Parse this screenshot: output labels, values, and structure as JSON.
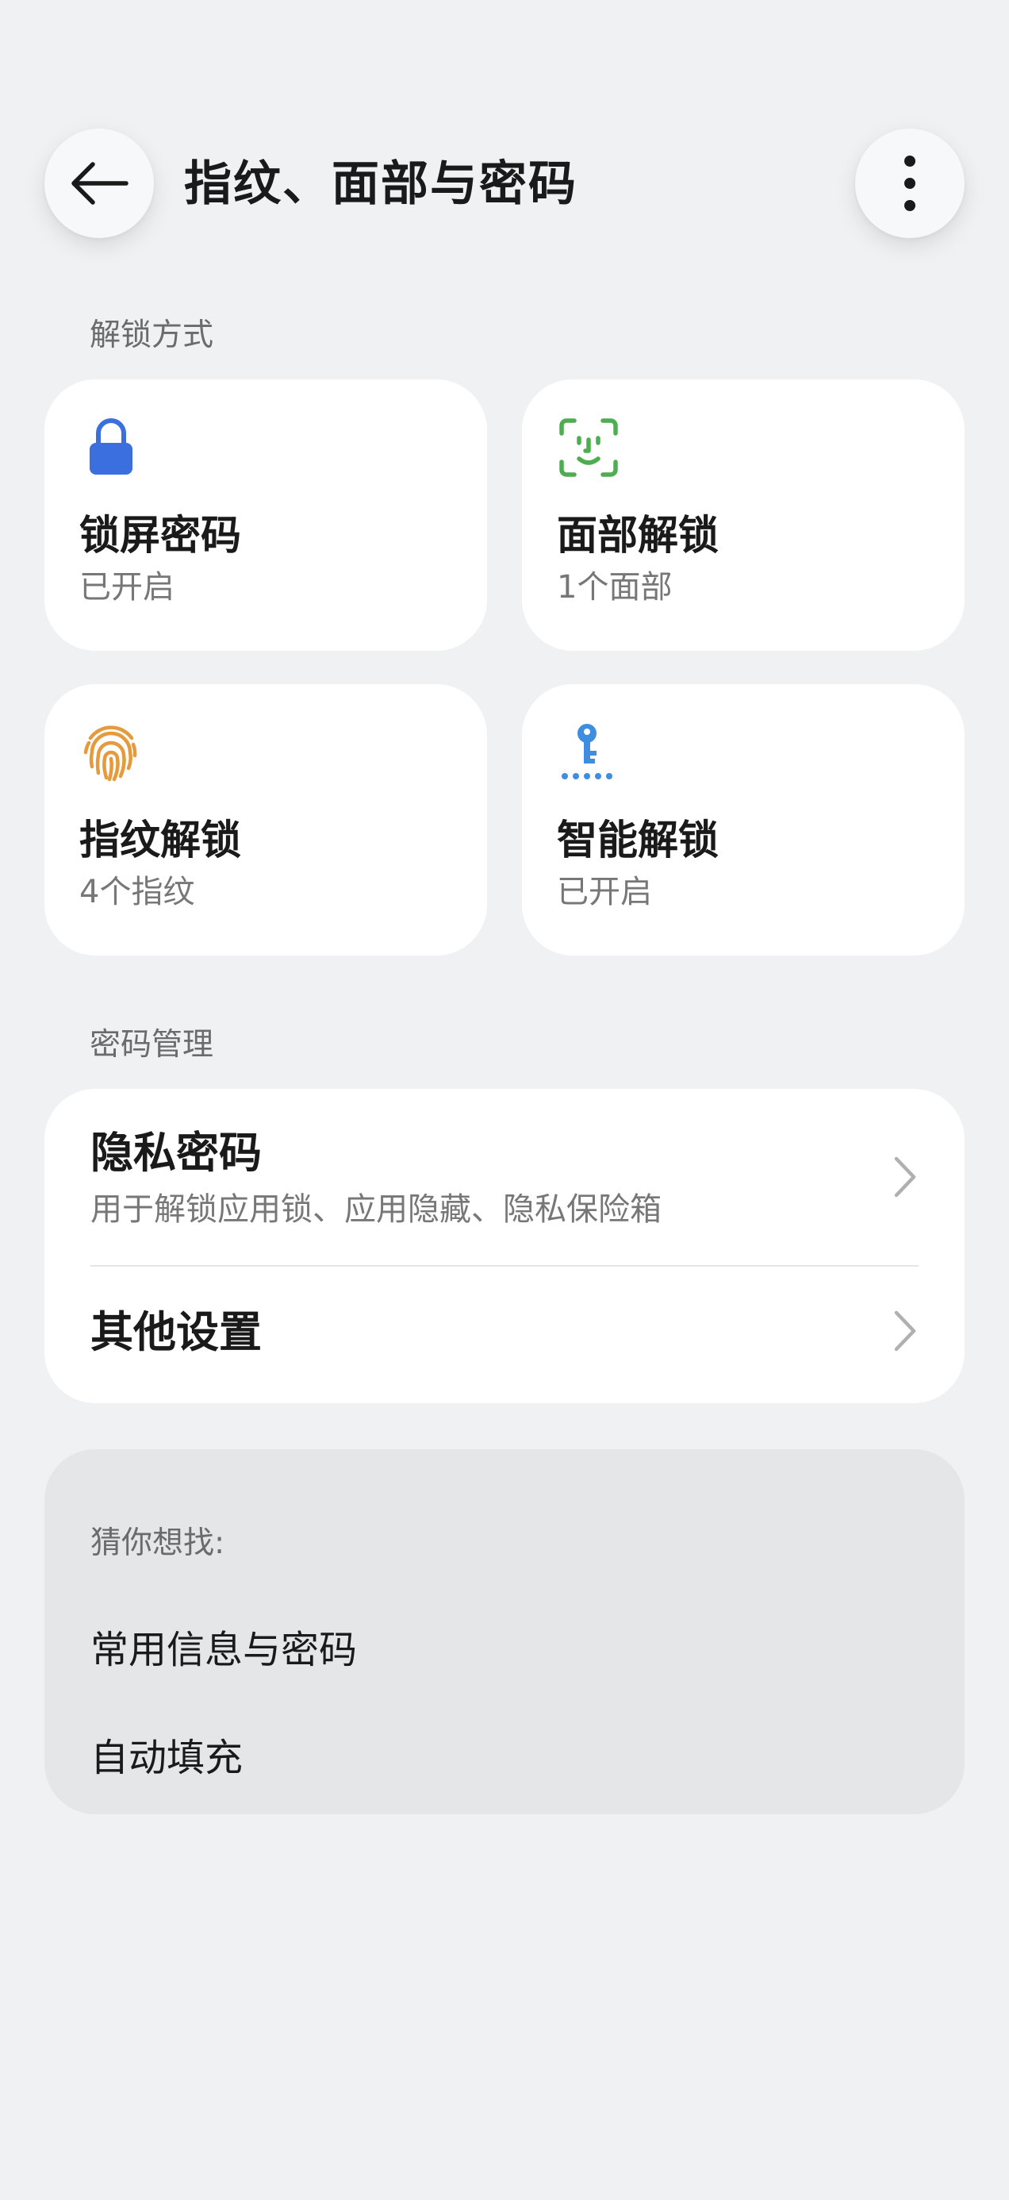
{
  "header": {
    "title": "指纹、面部与密码",
    "back_icon": "arrow-left-icon",
    "more_icon": "more-vertical-icon"
  },
  "sections": {
    "unlock_label": "解锁方式",
    "password_label": "密码管理"
  },
  "tiles": [
    {
      "title": "锁屏密码",
      "status": "已开启",
      "icon": "lock-icon",
      "color": "#3b6fe0"
    },
    {
      "title": "面部解锁",
      "status": "1个面部",
      "icon": "face-scan-icon",
      "color": "#4cae4f"
    },
    {
      "title": "指纹解锁",
      "status": "4个指纹",
      "icon": "fingerprint-icon",
      "color": "#e59a3c"
    },
    {
      "title": "智能解锁",
      "status": "已开启",
      "icon": "smart-key-icon",
      "color": "#3f8de0"
    }
  ],
  "password_mgmt": {
    "privacy_title": "隐私密码",
    "privacy_desc": "用于解锁应用锁、应用隐藏、隐私保险箱",
    "other_title": "其他设置"
  },
  "suggestions": {
    "label": "猜你想找:",
    "items": [
      "常用信息与密码",
      "自动填充"
    ]
  }
}
